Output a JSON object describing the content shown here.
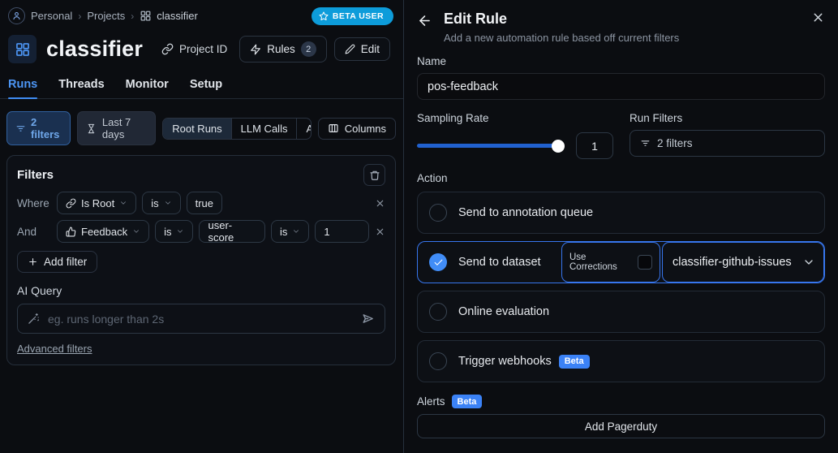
{
  "breadcrumb": {
    "items": [
      "Personal",
      "Projects",
      "classifier"
    ]
  },
  "beta_user_badge": "BETA USER",
  "project": {
    "title": "classifier",
    "project_id_label": "Project ID",
    "rules_label": "Rules",
    "rules_count": "2",
    "edit_label": "Edit"
  },
  "tabs": [
    {
      "label": "Runs",
      "active": true
    },
    {
      "label": "Threads",
      "active": false
    },
    {
      "label": "Monitor",
      "active": false
    },
    {
      "label": "Setup",
      "active": false
    }
  ],
  "toolbar": {
    "filters_button": "2 filters",
    "date_range": "Last 7 days",
    "segments": [
      "Root Runs",
      "LLM Calls",
      "All Runs"
    ],
    "columns_button": "Columns"
  },
  "filters_panel": {
    "title": "Filters",
    "row1": {
      "conjunction": "Where",
      "field": "Is Root",
      "op": "is",
      "value": "true"
    },
    "row2": {
      "conjunction": "And",
      "field": "Feedback",
      "op1": "is",
      "key": "user-score",
      "op2": "is",
      "value": "1"
    },
    "add_filter_label": "Add filter",
    "ai_query": {
      "label": "AI Query",
      "placeholder": "eg. runs longer than 2s"
    },
    "advanced_filters_link": "Advanced filters"
  },
  "drawer": {
    "title": "Edit Rule",
    "subtitle": "Add a new automation rule based off current filters",
    "name_label": "Name",
    "name_value": "pos-feedback",
    "sampling": {
      "label": "Sampling Rate",
      "value": "1"
    },
    "run_filters": {
      "label": "Run Filters",
      "button": "2 filters"
    },
    "action": {
      "label": "Action",
      "options": [
        {
          "label": "Send to annotation queue"
        },
        {
          "label": "Send to dataset",
          "use_corrections_label": "Use Corrections",
          "dataset_value": "classifier-github-issues"
        },
        {
          "label": "Online evaluation"
        },
        {
          "label": "Trigger webhooks",
          "badge": "Beta"
        }
      ],
      "selected_index": 1
    },
    "alerts": {
      "label": "Alerts",
      "badge": "Beta",
      "button": "Add Pagerduty"
    }
  },
  "colors": {
    "accent_blue": "#4d96f5",
    "slider_blue": "#2161cf",
    "radio_selected_blue": "#418df7",
    "selected_border_blue": "#3776ee",
    "beta_badge_blue": "#3b82f6",
    "beta_user_badge_blue": "#0d9cda",
    "background": "#0b0d11"
  }
}
